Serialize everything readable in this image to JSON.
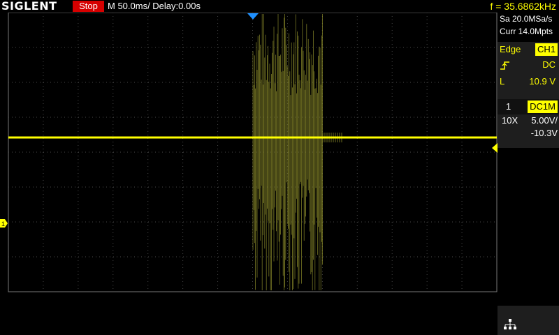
{
  "header": {
    "brand": "SIGLENT",
    "run_status": "Stop",
    "timebase": "M 50.0ms/ Delay:0.00s",
    "frequency": "f = 35.6862kHz"
  },
  "acquisition": {
    "sample_rate": "Sa 20.0MSa/s",
    "memory_depth": "Curr 14.0Mpts"
  },
  "trigger": {
    "type_label": "Edge",
    "source": "CH1",
    "coupling": "DC",
    "level_label": "L",
    "level_value": "10.9 V",
    "slope_icon": "rising-edge-icon"
  },
  "channel": {
    "number": "1",
    "coupling": "DC1M",
    "probe": "10X",
    "scale": "5.00V/",
    "offset": "-10.3V",
    "marker_label": "1"
  },
  "colors": {
    "trace": "#ffff00",
    "trace_dim": "#8a8a2a",
    "grid": "#4a4a4a",
    "stop_red": "#d60000",
    "delay_marker": "#1e90ff",
    "panel_bg": "#1e1e1e"
  },
  "icons": {
    "network": "network-icon"
  }
}
